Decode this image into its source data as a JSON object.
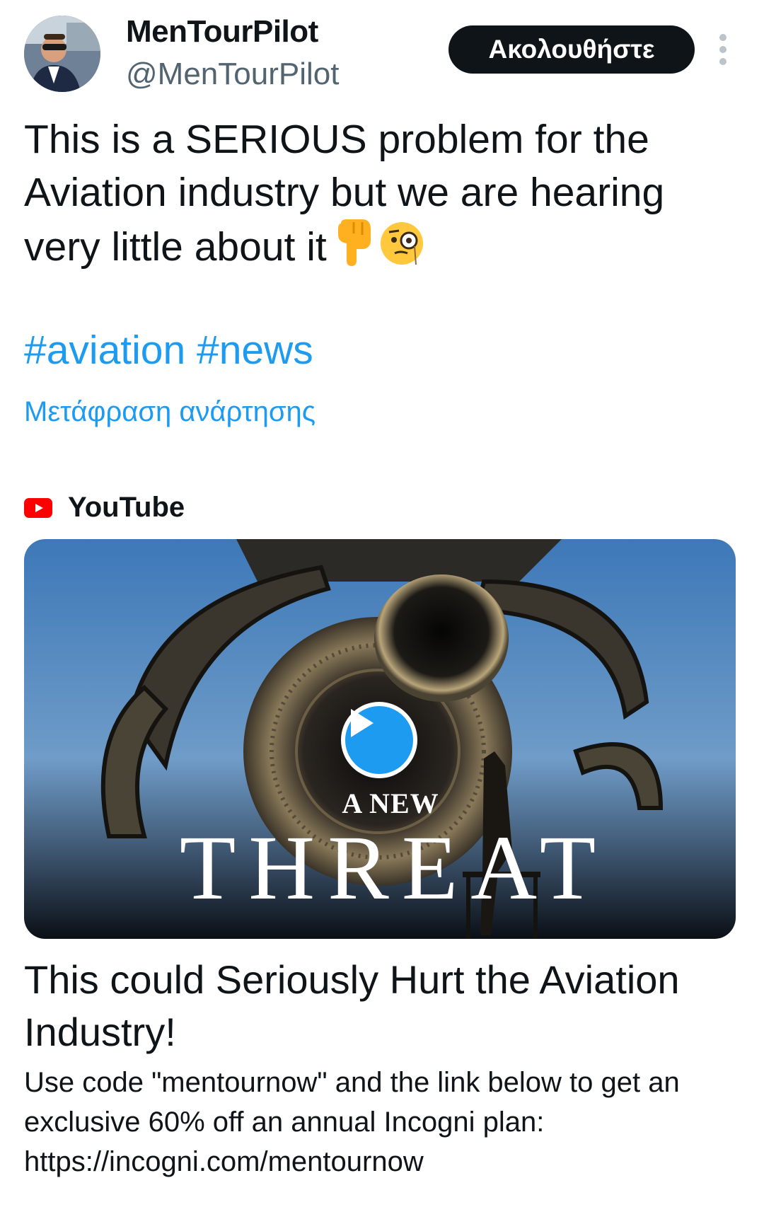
{
  "author": {
    "display_name": "MenTourPilot",
    "handle": "@MenTourPilot"
  },
  "follow_label": "Ακολουθήστε",
  "tweet": {
    "text": "This is a SERIOUS problem for the\nAviation industry but we are hearing\nvery little about it",
    "emojis": [
      "backhand-index-pointing-down",
      "face-with-monocle"
    ],
    "hashtags": [
      "#aviation",
      "#news"
    ],
    "translate_label": "Μετάφραση ανάρτησης"
  },
  "card": {
    "source": "YouTube",
    "thumbnail_text_small": "A NEW",
    "thumbnail_text_big": "THREAT",
    "title": "This could Seriously Hurt the Aviation Industry!",
    "description": "Use code \"mentournow\" and the link below to get an exclusive 60% off an annual Incogni plan: https://incogni.com/mentournow"
  },
  "colors": {
    "link": "#1d9bf0",
    "text": "#0f1419",
    "secondary": "#536471",
    "button_bg": "#0f1419",
    "youtube_red": "#ff0000"
  }
}
